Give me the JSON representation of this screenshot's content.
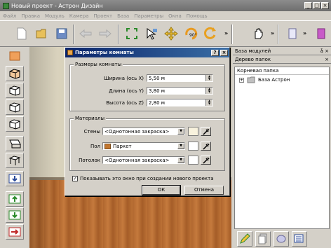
{
  "window": {
    "title": "Новый проект - Астрон Дизайн",
    "controls": [
      "_",
      "□",
      "×"
    ]
  },
  "menu": [
    "Файл",
    "Правка",
    "Модуль",
    "Камера",
    "Проект",
    "База",
    "Параметры",
    "Окна",
    "Помощь"
  ],
  "toolbar": {
    "icons": [
      "new-file-icon",
      "open-folder-icon",
      "save-icon",
      "undo-icon",
      "redo-icon",
      "fit-view-icon",
      "select-arrow-icon",
      "move-icon",
      "rotate-90-icon",
      "rotate-icon",
      "hand-icon",
      "module-icon"
    ],
    "rotate_label": "90°",
    "more": "»"
  },
  "right_panel": {
    "modules_header": "База модулей",
    "folders_header": "Дерево папок",
    "pin": "ǡ ×",
    "tree_root": "Корневая папка",
    "tree_item": "База Астрон",
    "tree_expander": "+"
  },
  "dialog": {
    "title": "Параметры комнаты",
    "help_btn": "?",
    "close_btn": "×",
    "size_group": "Размеры комнаты",
    "width_label": "Ширина (ось X)",
    "width_value": "5,50 м",
    "length_label": "Длина (ось Y)",
    "length_value": "3,80 м",
    "height_label": "Высота (ось Z)",
    "height_value": "2,80 м",
    "materials_group": "Материалы",
    "walls_label": "Стены",
    "walls_value": "<Однотонная закраска>",
    "floor_label": "Пол",
    "floor_value": "Паркет",
    "ceiling_label": "Потолок",
    "ceiling_value": "<Однотонная закраска>",
    "checkbox_checked": "✓",
    "checkbox_label": "Показывать это окно при создании нового проекта",
    "ok_label": "ОК",
    "cancel_label": "Отмена"
  },
  "colors": {
    "title_active": "#0a246a",
    "wall_swatch": "#f8f2dd",
    "parquet": "#c2762f"
  }
}
